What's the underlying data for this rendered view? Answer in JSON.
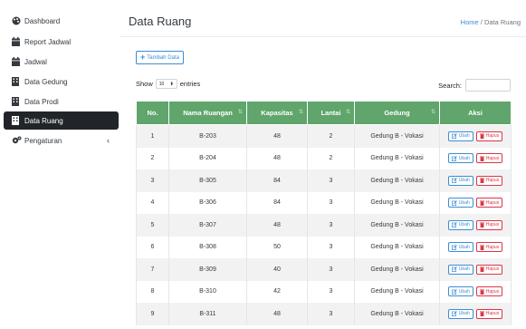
{
  "sidebar": {
    "items": [
      {
        "label": "Dashboard",
        "icon": "palette-icon"
      },
      {
        "label": "Report Jadwal",
        "icon": "calendar-icon"
      },
      {
        "label": "Jadwal",
        "icon": "calendar-icon"
      },
      {
        "label": "Data Gedung",
        "icon": "building-icon"
      },
      {
        "label": "Data Prodi",
        "icon": "building-icon"
      },
      {
        "label": "Data Ruang",
        "icon": "building-icon",
        "active": true
      },
      {
        "label": "Pengaturan",
        "icon": "cogs-icon",
        "chevron": "‹"
      }
    ]
  },
  "header": {
    "title": "Data Ruang",
    "breadcrumb_home": "Home",
    "breadcrumb_sep": "/",
    "breadcrumb_current": "Data Ruang"
  },
  "toolbar": {
    "add_label": "Tambah Data",
    "show_label": "Show",
    "entries_value": "10",
    "entries_label": "entries",
    "search_label": "Search:"
  },
  "table": {
    "columns": [
      "No.",
      "Nama Ruangan",
      "Kapasitas",
      "Lantai",
      "Gedung",
      "Aksi"
    ],
    "edit_label": "Ubah",
    "delete_label": "Hapus",
    "rows": [
      {
        "no": "1",
        "nama": "B-203",
        "kapasitas": "48",
        "lantai": "2",
        "gedung": "Gedung B - Vokasi"
      },
      {
        "no": "2",
        "nama": "B-204",
        "kapasitas": "48",
        "lantai": "2",
        "gedung": "Gedung B - Vokasi"
      },
      {
        "no": "3",
        "nama": "B-305",
        "kapasitas": "84",
        "lantai": "3",
        "gedung": "Gedung B - Vokasi"
      },
      {
        "no": "4",
        "nama": "B-306",
        "kapasitas": "84",
        "lantai": "3",
        "gedung": "Gedung B - Vokasi"
      },
      {
        "no": "5",
        "nama": "B-307",
        "kapasitas": "48",
        "lantai": "3",
        "gedung": "Gedung B - Vokasi"
      },
      {
        "no": "6",
        "nama": "B-308",
        "kapasitas": "50",
        "lantai": "3",
        "gedung": "Gedung B - Vokasi"
      },
      {
        "no": "7",
        "nama": "B-309",
        "kapasitas": "40",
        "lantai": "3",
        "gedung": "Gedung B - Vokasi"
      },
      {
        "no": "8",
        "nama": "B-310",
        "kapasitas": "42",
        "lantai": "3",
        "gedung": "Gedung B - Vokasi"
      },
      {
        "no": "9",
        "nama": "B-311",
        "kapasitas": "48",
        "lantai": "3",
        "gedung": "Gedung B - Vokasi"
      }
    ]
  },
  "colors": {
    "header_green": "#5fa56c",
    "primary_blue": "#3b8dd6",
    "danger_red": "#dc3545",
    "sidebar_active": "#212529"
  }
}
